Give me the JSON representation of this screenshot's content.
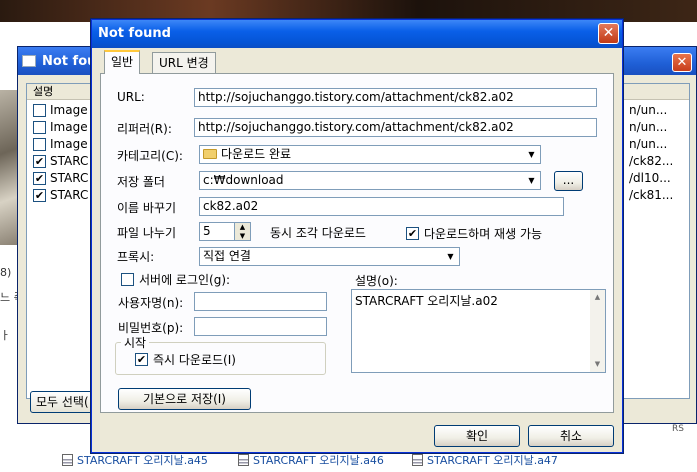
{
  "background": {
    "left_texts": [
      "8)",
      "느 즉",
      "ㅏ"
    ],
    "links": [
      {
        "text": "STARCRAFT 오리지날.a45"
      },
      {
        "text": "STARCRAFT 오리지날.a46"
      },
      {
        "text": "STARCRAFT 오리지날.a47"
      }
    ],
    "rss": "RS"
  },
  "back_window": {
    "title": "Not fou",
    "column_header": "설명",
    "rows": [
      {
        "label": "Image",
        "checked": false,
        "right": "n/un..."
      },
      {
        "label": "Image",
        "checked": false,
        "right": "n/un..."
      },
      {
        "label": "Image",
        "checked": false,
        "right": "n/un..."
      },
      {
        "label": "STARC",
        "checked": true,
        "right": "/ck82..."
      },
      {
        "label": "STARC",
        "checked": true,
        "right": "/dl10..."
      },
      {
        "label": "STARC",
        "checked": true,
        "right": "/ck81..."
      }
    ],
    "select_all_button": "모두 선택(",
    "close_glyph": "✕"
  },
  "dialog": {
    "title": "Not found",
    "close_glyph": "✕",
    "tabs": [
      {
        "label": "일반"
      },
      {
        "label": "URL 변경"
      }
    ],
    "url_label": "URL:",
    "url_value": "http://sojuchanggo.tistory.com/attachment/ck82.a02",
    "referrer_label": "리퍼러(R):",
    "referrer_value": "http://sojuchanggo.tistory.com/attachment/ck82.a02",
    "category_label": "카테고리(C):",
    "category_value": "다운로드 완료",
    "save_folder_label": "저장 폴더",
    "save_folder_value": "c:₩download",
    "browse_button": "...",
    "rename_label": "이름 바꾸기",
    "rename_value": "ck82.a02",
    "split_label": "파일 나누기",
    "split_value": "5",
    "split_suffix": "동시 조각 다운로드",
    "play_while_download": {
      "label": "다운로드하며 재생 가능",
      "checked": true
    },
    "proxy_label": "프록시:",
    "proxy_value": "직접 연결",
    "server_login": {
      "label": "서버에 로그인(g):",
      "checked": false
    },
    "username_label": "사용자명(n):",
    "username_value": "",
    "password_label": "비밀번호(p):",
    "password_value": "",
    "start_group_label": "시작",
    "download_now": {
      "label": "즉시 다운로드(I)",
      "checked": true
    },
    "description_label": "설명(o):",
    "description_value": "STARCRAFT 오리지날.a02",
    "save_default_button": "기본으로 저장(I)",
    "ok_button": "확인",
    "cancel_button": "취소"
  }
}
